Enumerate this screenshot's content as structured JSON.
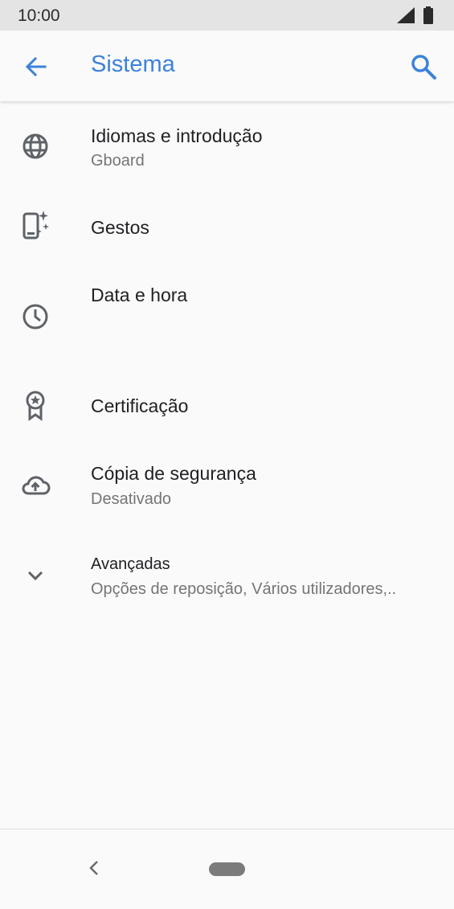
{
  "status_bar": {
    "time": "10:00",
    "icons": [
      "signal-icon",
      "battery-icon"
    ]
  },
  "app_bar": {
    "title": "Sistema",
    "back_icon": "arrow-back-icon",
    "search_icon": "search-icon"
  },
  "settings": [
    {
      "id": "languages",
      "title": "Idiomas e introdução",
      "subtitle": "Gboard",
      "icon": "globe-icon"
    },
    {
      "id": "gestures",
      "title": "Gestos",
      "subtitle": "",
      "icon": "gestures-icon"
    },
    {
      "id": "datetime",
      "title": "Data e hora",
      "subtitle": "",
      "icon": "clock-icon"
    },
    {
      "id": "certification",
      "title": "Certificação",
      "subtitle": "",
      "icon": "certificate-icon"
    },
    {
      "id": "backup",
      "title": "Cópia de segurança",
      "subtitle": "Desativado",
      "icon": "cloud-upload-icon"
    },
    {
      "id": "advanced",
      "title": "Avançadas",
      "subtitle": "Opções de reposição, Vários utilizadores,..",
      "icon": "chevron-down-icon"
    }
  ],
  "nav_bar": {
    "back_icon": "nav-back-icon",
    "home_icon": "home-pill-icon"
  },
  "colors": {
    "accent": "#3c82d9",
    "icon": "#5f6368",
    "background": "#fafafa",
    "status_bar": "#e4e4e4"
  }
}
